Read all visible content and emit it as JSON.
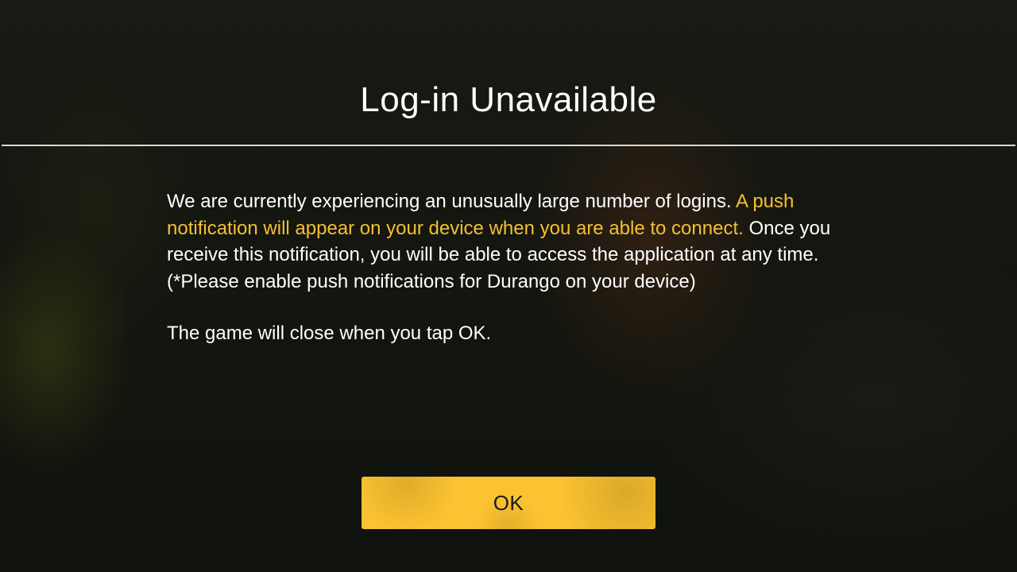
{
  "dialog": {
    "title": "Log-in Unavailable",
    "message_part1": "We are currently experiencing an unusually large number of logins. ",
    "message_highlight": "A push notification will appear on your device when you are able to connect.",
    "message_part2": " Once you receive this notification, you will be able to access the application at any time. (*Please enable push notifications for Durango on your device)",
    "close_note": "The game will close when you tap OK.",
    "ok_label": "OK"
  },
  "colors": {
    "accent": "#fbc232",
    "highlight_text": "#f4c02e",
    "background": "#141610"
  }
}
